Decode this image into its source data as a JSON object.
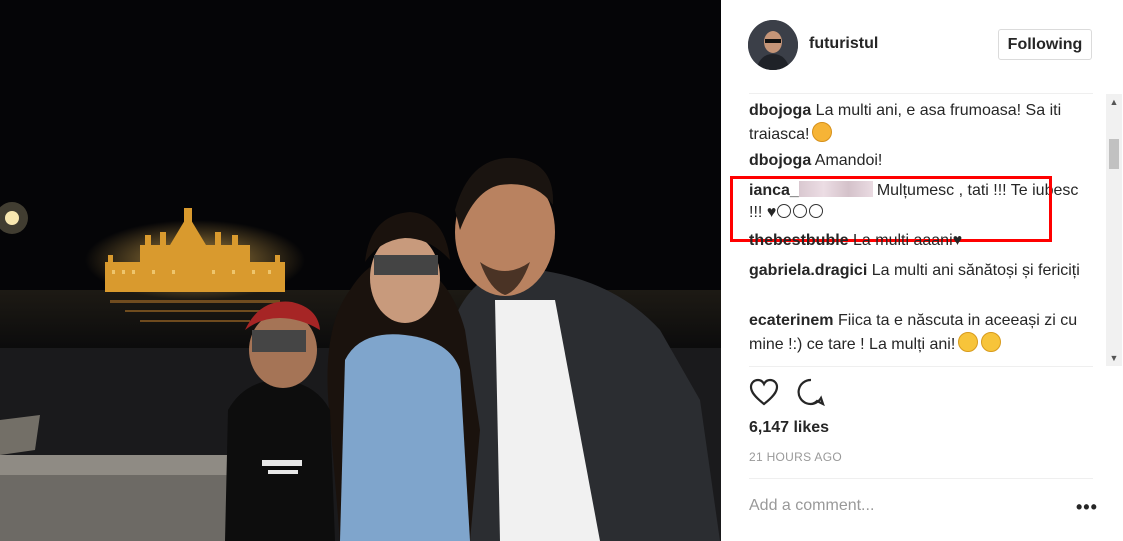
{
  "post": {
    "username": "futuristul",
    "follow_label": "Following",
    "likes": "6,147 likes",
    "time_ago": "21 HOURS AGO",
    "add_comment_placeholder": "Add a comment...",
    "more_label": "•••"
  },
  "comments": [
    {
      "user": "dbojoga",
      "text": "La multi ani, e asa frumoasa! Sa iti traiasca!",
      "emoji": "kiss"
    },
    {
      "user": "dbojoga",
      "text": "Amandoi!"
    },
    {
      "user": "ianca_",
      "text": "Mulțumesc , tati !!! Te iubesc !!! ♥",
      "blurred": true,
      "emoji": "shocked"
    },
    {
      "user": "thebestbuble",
      "text": "La multi aaani♥"
    },
    {
      "user": "gabriela.dragici",
      "text": "La multi ani sănătoși și fericiți"
    },
    {
      "user": "ecaterinem",
      "text": "Fiica ta e născuta in aceeași zi cu mine !:) ce tare ! La mulți ani!",
      "emoji": "grin"
    }
  ],
  "colors": {
    "highlight": "#ff0000",
    "text": "#262626",
    "muted": "#999999"
  },
  "icons": [
    "heart-icon",
    "comment-icon",
    "more-icon",
    "scroll-up-icon",
    "scroll-down-icon"
  ]
}
